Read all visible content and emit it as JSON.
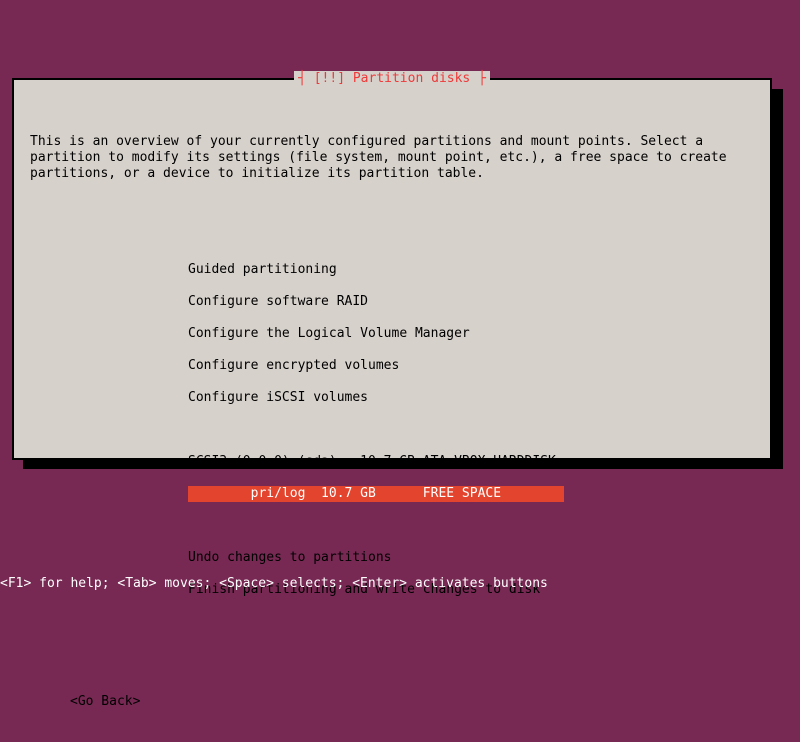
{
  "dialog": {
    "title": "[!!] Partition disks",
    "intro": "This is an overview of your currently configured partitions and mount points. Select a partition to modify its settings (file system, mount point, etc.), a free space to create partitions, or a device to initialize its partition table.",
    "menu1": {
      "guided": "Guided partitioning",
      "raid": "Configure software RAID",
      "lvm": "Configure the Logical Volume Manager",
      "encrypted": "Configure encrypted volumes",
      "iscsi": "Configure iSCSI volumes"
    },
    "disk_header": "SCSI3 (0,0,0) (sda) - 10.7 GB ATA VBOX HARDDISK",
    "selected_line": "        pri/log  10.7 GB      FREE SPACE        ",
    "menu2": {
      "undo": "Undo changes to partitions",
      "finish": "Finish partitioning and write changes to disk"
    },
    "goback": "<Go Back>"
  },
  "help_line": "<F1> for help; <Tab> moves; <Space> selects; <Enter> activates buttons"
}
